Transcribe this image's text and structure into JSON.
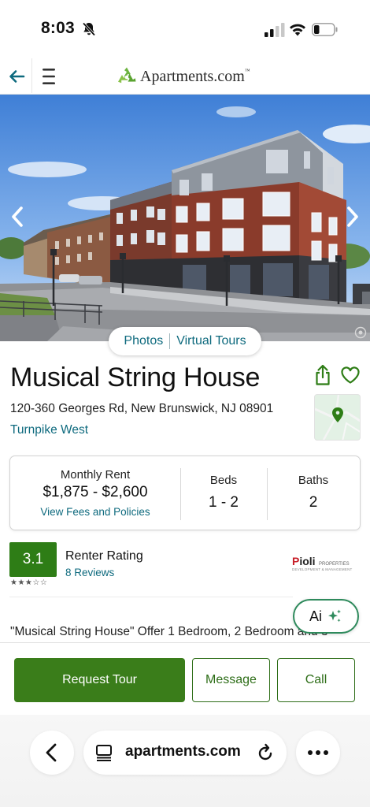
{
  "status_bar": {
    "time": "8:03"
  },
  "header": {
    "logo_text": "Apartments.com",
    "logo_tm": "™"
  },
  "hero": {
    "media_tabs": [
      "Photos",
      "Virtual Tours"
    ]
  },
  "listing": {
    "name": "Musical String House",
    "address": "120-360 Georges Rd, New Brunswick, NJ 08901",
    "neighborhood": "Turnpike West"
  },
  "rent_card": {
    "rent_label": "Monthly Rent",
    "rent_value": "$1,875 - $2,600",
    "fees_link": "View Fees and Policies",
    "beds_label": "Beds",
    "beds_value": "1 - 2",
    "baths_label": "Baths",
    "baths_value": "2"
  },
  "rating": {
    "score": "3.1",
    "stars": "★★★☆☆",
    "label": "Renter Rating",
    "reviews": "8 Reviews",
    "stars_filled": 3,
    "stars_total": 5
  },
  "management_logo": {
    "name_prefix": "P",
    "name_rest": "ioli",
    "subtitle": "PROPERTIES",
    "tagline": "DEVELOPMENT & MANAGEMENT"
  },
  "ai_button": {
    "label": "Ai"
  },
  "description": {
    "text": "\"Musical String House\" Offer 1 Bedroom, 2 Bedroom and 3"
  },
  "actions": {
    "request_tour": "Request Tour",
    "message": "Message",
    "call": "Call"
  },
  "browser": {
    "url": "apartments.com"
  },
  "colors": {
    "brand_green": "#3a7d1a",
    "link_teal": "#0e6a7e",
    "rating_green": "#2e7d16"
  }
}
